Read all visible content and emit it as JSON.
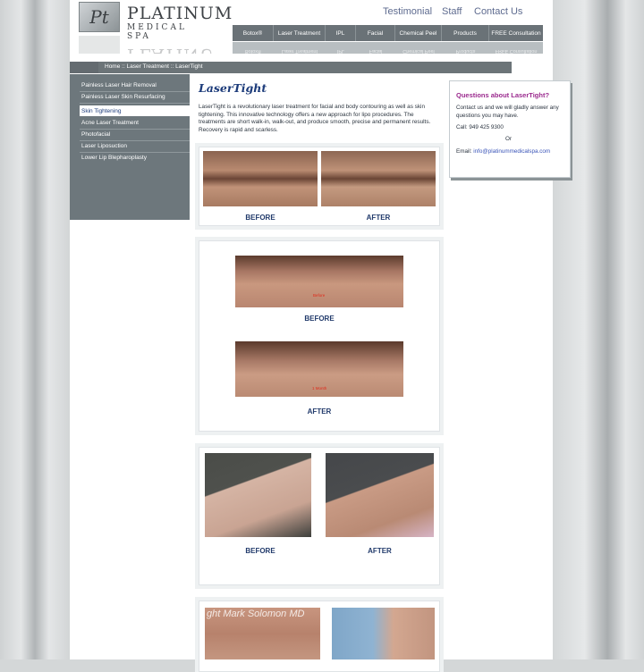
{
  "colors": {
    "background": "#d4d7d8",
    "nav": "#6a7277",
    "title": "#1c3b7a",
    "accent": "#9b2a8e",
    "link": "#3a54b8"
  },
  "header": {
    "logo_monogram": "Pt",
    "logo_name": "PLATINUM",
    "logo_subtitle": "MEDICAL SPA",
    "top_links": [
      "Testimonial",
      "Staff",
      "Contact Us"
    ],
    "nav_items": [
      {
        "label": "Botox®"
      },
      {
        "label": "Laser Treatment"
      },
      {
        "label": "IPL"
      },
      {
        "label": "Facial"
      },
      {
        "label": "Chemical Peel"
      },
      {
        "label": "Products"
      },
      {
        "label": "FREE Consultation"
      }
    ]
  },
  "breadcrumb": "Home :: Laser Treatment :: LaserTight",
  "sidebar": {
    "items": [
      {
        "label": "Painless Laser Hair Removal"
      },
      {
        "label": "Painless Laser Skin Resurfacing"
      },
      {
        "label": "Skin Tightening",
        "active": true
      },
      {
        "label": "Acne Laser Treatment"
      },
      {
        "label": "Photofacial"
      },
      {
        "label": "Laser Liposuction"
      },
      {
        "label": "Lower Lip Blepharoplasty"
      }
    ]
  },
  "main": {
    "title": "LaserTight",
    "intro": "LaserTight is a revolutionary laser treatment for facial and body contouring as well as skin tightening. This innovative technology offers a new approach for lipo procedures. The treatments are short walk-in, walk-out, and produce smooth, precise and permanent results. Recovery is rapid and scarless.",
    "panels": [
      {
        "before_label": "BEFORE",
        "after_label": "AFTER"
      },
      {
        "before_label": "BEFORE",
        "after_label": "AFTER",
        "before_tag": "Before",
        "after_tag": "1 Month"
      },
      {
        "before_label": "BEFORE",
        "after_label": "AFTER"
      },
      {
        "watermark": "ght Mark Solomon MD"
      }
    ]
  },
  "question_box": {
    "title": "Questions about LaserTight?",
    "text": "Contact us and we will gladly answer any questions you may have.",
    "call": "Call: 949 425 9300",
    "or": "Or",
    "email_label": "Email:",
    "email": "info@platinummedicalspa.com"
  }
}
